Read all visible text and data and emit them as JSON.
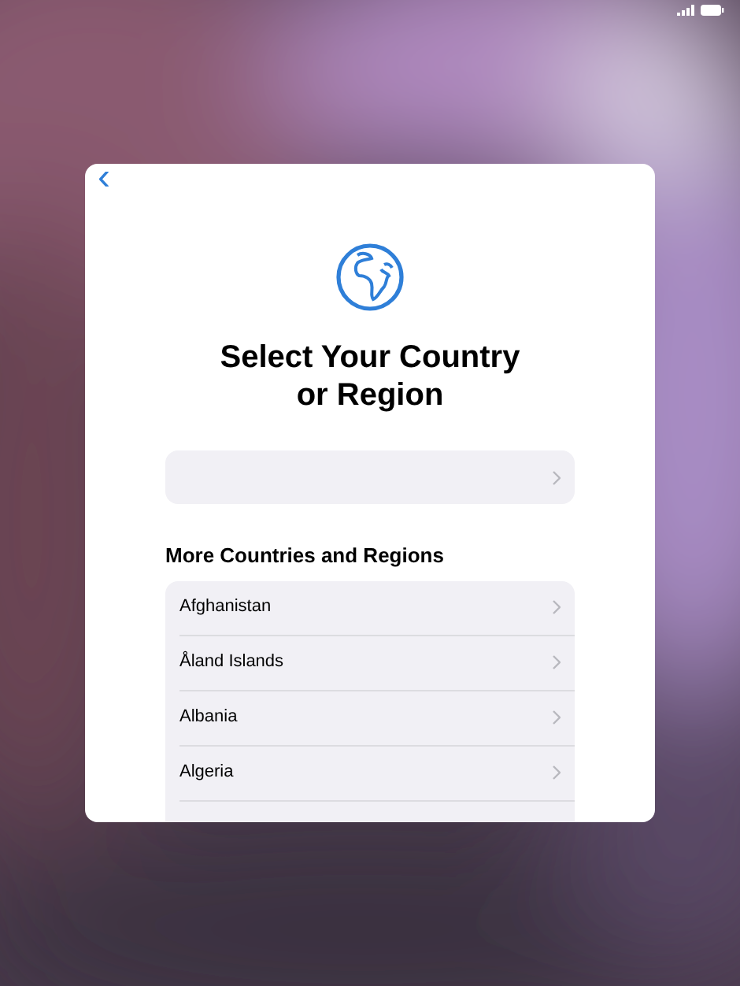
{
  "screen": {
    "title": "Select Your Country or Region",
    "back": "‹"
  },
  "section": {
    "header": "More Countries and Regions",
    "items": [
      {
        "label": "Afghanistan"
      },
      {
        "label": "Åland Islands"
      },
      {
        "label": "Albania"
      },
      {
        "label": "Algeria"
      }
    ]
  }
}
